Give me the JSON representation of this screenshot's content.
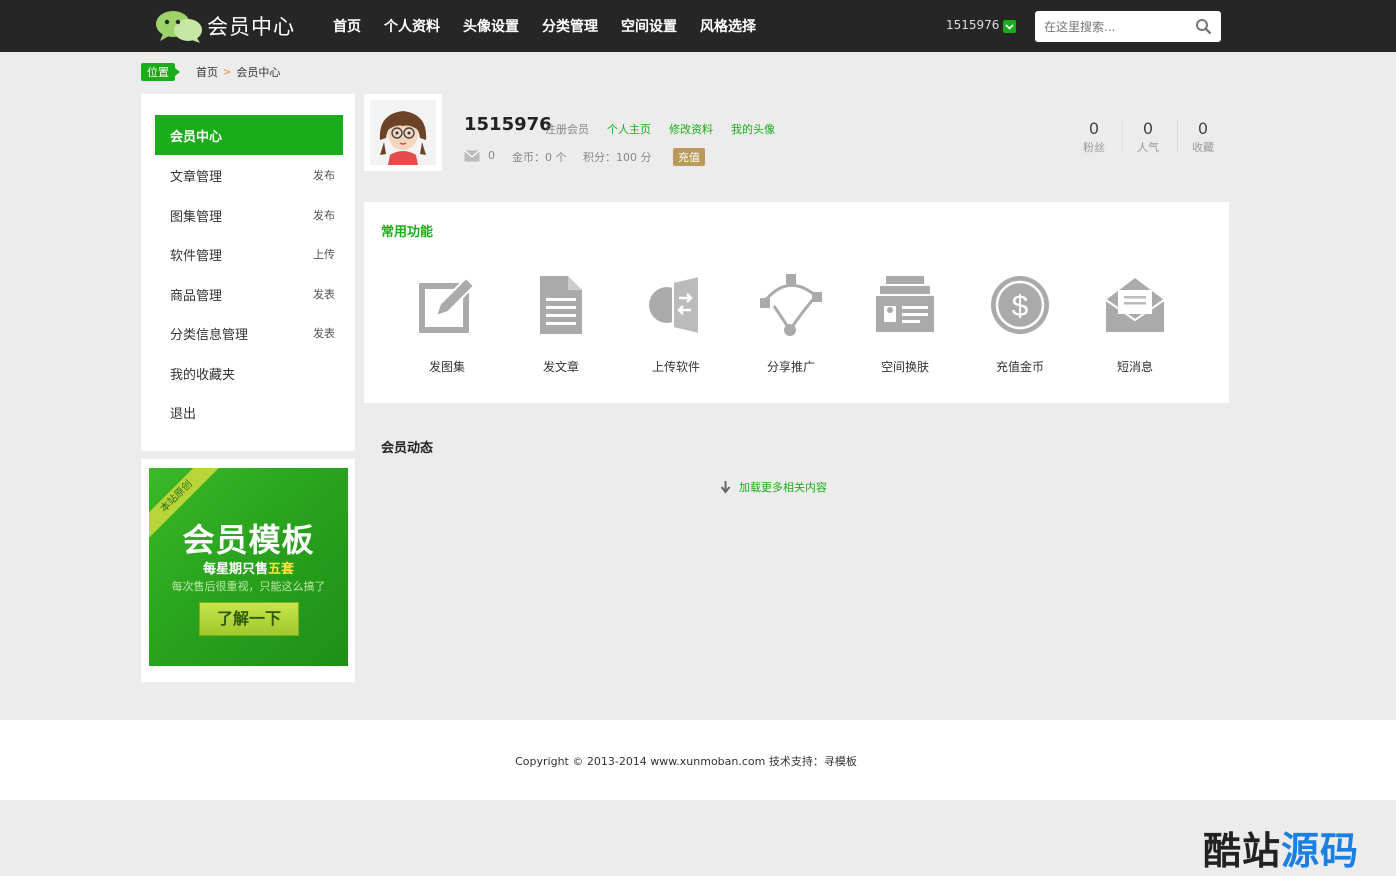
{
  "header": {
    "logo_text": "会员中心",
    "nav": [
      "首页",
      "个人资料",
      "头像设置",
      "分类管理",
      "空间设置",
      "风格选择"
    ],
    "username": "1515976",
    "search_placeholder": "在这里搜索..."
  },
  "breadcrumb": {
    "tag": "位置",
    "items": [
      "首页",
      "会员中心"
    ],
    "separator": ">"
  },
  "sidebar": {
    "items": [
      {
        "label": "会员中心",
        "action": ""
      },
      {
        "label": "文章管理",
        "action": "发布"
      },
      {
        "label": "图集管理",
        "action": "发布"
      },
      {
        "label": "软件管理",
        "action": "上传"
      },
      {
        "label": "商品管理",
        "action": "发表"
      },
      {
        "label": "分类信息管理",
        "action": "发表"
      },
      {
        "label": "我的收藏夹",
        "action": ""
      },
      {
        "label": "退出",
        "action": ""
      }
    ]
  },
  "promo": {
    "ribbon": "本站原创",
    "title": "会员模板",
    "sub_prefix": "每星期只售",
    "sub_highlight": "五套",
    "sub2": "每次售后很重视，只能这么搞了",
    "button": "了解一下"
  },
  "profile": {
    "name": "1515976",
    "role": "注册会员",
    "links": [
      "个人主页",
      "修改资料",
      "我的头像"
    ],
    "messages": "0",
    "gold": "金币：0 个",
    "score": "积分：100 分",
    "recharge": "充值",
    "stats": [
      {
        "num": "0",
        "label": "粉丝"
      },
      {
        "num": "0",
        "label": "人气"
      },
      {
        "num": "0",
        "label": "收藏"
      }
    ]
  },
  "functions": {
    "title": "常用功能",
    "items": [
      {
        "label": "发图集",
        "icon": "edit-icon"
      },
      {
        "label": "发文章",
        "icon": "document-icon"
      },
      {
        "label": "上传软件",
        "icon": "upload-software-icon"
      },
      {
        "label": "分享推广",
        "icon": "share-icon"
      },
      {
        "label": "空间换肤",
        "icon": "skin-icon"
      },
      {
        "label": "充值金币",
        "icon": "dollar-coin-icon"
      },
      {
        "label": "短消息",
        "icon": "envelope-icon"
      }
    ]
  },
  "activity": {
    "title": "会员动态",
    "load_more": "加载更多相关内容"
  },
  "footer": {
    "copyright": "Copyright © 2013-2014 www.xunmoban.com 技术支持：寻模板"
  },
  "watermark": {
    "part1": "酷站",
    "part2": "源码"
  },
  "colors": {
    "accent": "#1aad19",
    "topbar": "#262626",
    "background": "#ececec"
  }
}
